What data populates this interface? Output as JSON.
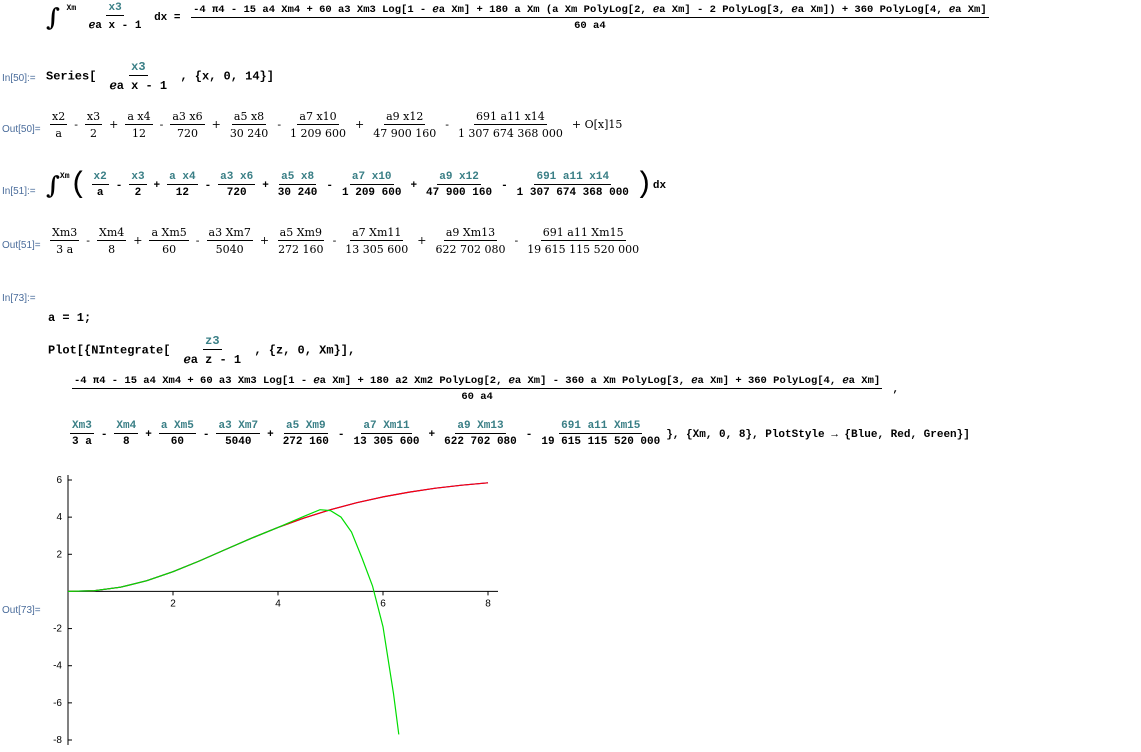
{
  "cells": {
    "top_expr": {
      "lhs_int_upper": "Xm",
      "lhs_int_lower": "0",
      "lhs_num": "x3",
      "lhs_den": "ℯa x - 1",
      "lhs_dx": "dx =",
      "rhs_num": "-4 π4 - 15 a4 Xm4 + 60 a3 Xm3 Log[1 - ℯa Xm] + 180 a Xm (a Xm PolyLog[2, ℯa Xm] - 2 PolyLog[3, ℯa Xm]) + 360 PolyLog[4, ℯa Xm]",
      "rhs_den": "60 a4"
    },
    "in50": {
      "label": "In[50]:=",
      "text_pre": "Series[",
      "num": "x3",
      "den": "ℯa x - 1",
      "text_post": ", {x, 0, 14}]"
    },
    "out50": {
      "label": "Out[50]=",
      "terms": [
        {
          "num": "x2",
          "den": "a",
          "op": "-"
        },
        {
          "num": "x3",
          "den": "2",
          "op": "+"
        },
        {
          "num": "a x4",
          "den": "12",
          "op": "-"
        },
        {
          "num": "a3 x6",
          "den": "720",
          "op": "+"
        },
        {
          "num": "a5 x8",
          "den": "30 240",
          "op": "-"
        },
        {
          "num": "a7 x10",
          "den": "1 209 600",
          "op": "+"
        },
        {
          "num": "a9 x12",
          "den": "47 900 160",
          "op": "-"
        },
        {
          "num": "691 a11 x14",
          "den": "1 307 674 368 000",
          "op": "+ O[x]15"
        }
      ]
    },
    "in51": {
      "label": "In[51]:=",
      "upper": "Xm",
      "lower": "0",
      "terms": [
        {
          "num": "x2",
          "den": "a",
          "op": "-"
        },
        {
          "num": "x3",
          "den": "2",
          "op": "+"
        },
        {
          "num": "a x4",
          "den": "12",
          "op": "-"
        },
        {
          "num": "a3 x6",
          "den": "720",
          "op": "+"
        },
        {
          "num": "a5 x8",
          "den": "30 240",
          "op": "-"
        },
        {
          "num": "a7 x10",
          "den": "1 209 600",
          "op": "+"
        },
        {
          "num": "a9 x12",
          "den": "47 900 160",
          "op": "-"
        },
        {
          "num": "691 a11 x14",
          "den": "1 307 674 368 000",
          "op": ""
        }
      ],
      "dx": "dx"
    },
    "out51": {
      "label": "Out[51]=",
      "terms": [
        {
          "num": "Xm3",
          "den": "3 a",
          "op": "-"
        },
        {
          "num": "Xm4",
          "den": "8",
          "op": "+"
        },
        {
          "num": "a Xm5",
          "den": "60",
          "op": "-"
        },
        {
          "num": "a3 Xm7",
          "den": "5040",
          "op": "+"
        },
        {
          "num": "a5 Xm9",
          "den": "272 160",
          "op": "-"
        },
        {
          "num": "a7 Xm11",
          "den": "13 305 600",
          "op": "+"
        },
        {
          "num": "a9 Xm13",
          "den": "622 702 080",
          "op": "-"
        },
        {
          "num": "691 a11 Xm15",
          "den": "19 615 115 520 000",
          "op": ""
        }
      ]
    },
    "in73": {
      "label": "In[73]:=",
      "line1": "a = 1;",
      "plot_pre": "Plot[{NIntegrate[",
      "plot_num": "z3",
      "plot_den": "ℯa z - 1",
      "plot_post": ", {z, 0, Xm}],",
      "line3_num": "-4 π4 - 15 a4 Xm4 + 60 a3 Xm3 Log[1 - ℯa Xm] + 180 a2 Xm2 PolyLog[2, ℯa Xm] - 360 a Xm PolyLog[3, ℯa Xm] + 360 PolyLog[4, ℯa Xm]",
      "line3_den": "60 a4",
      "line3_post": ",",
      "line4_terms": [
        {
          "num": "Xm3",
          "den": "3 a",
          "op": "-"
        },
        {
          "num": "Xm4",
          "den": "8",
          "op": "+"
        },
        {
          "num": "a Xm5",
          "den": "60",
          "op": "-"
        },
        {
          "num": "a3 Xm7",
          "den": "5040",
          "op": "+"
        },
        {
          "num": "a5 Xm9",
          "den": "272 160",
          "op": "-"
        },
        {
          "num": "a7 Xm11",
          "den": "13 305 600",
          "op": "+"
        },
        {
          "num": "a9 Xm13",
          "den": "622 702 080",
          "op": "-"
        },
        {
          "num": "691 a11 Xm15",
          "den": "19 615 115 520 000",
          "op": ""
        }
      ],
      "line4_post": "}, {Xm, 0, 8}, PlotStyle → {Blue, Red, Green}]"
    },
    "out73": {
      "label": "Out[73]="
    }
  },
  "chart_data": {
    "type": "line",
    "xlim": [
      0,
      8
    ],
    "ylim": [
      -8,
      6
    ],
    "xticks": [
      2,
      4,
      6,
      8
    ],
    "yticks": [
      -8,
      -6,
      -4,
      -2,
      2,
      4,
      6
    ],
    "series": [
      {
        "color": "#0000ff",
        "x": [
          0,
          0.5,
          1,
          1.5,
          2,
          2.5,
          3,
          3.5,
          4,
          4.5,
          5,
          5.5,
          6,
          6.5,
          7,
          7.5,
          8
        ],
        "y": [
          0,
          0.04,
          0.23,
          0.58,
          1.06,
          1.64,
          2.26,
          2.87,
          3.45,
          3.96,
          4.4,
          4.78,
          5.09,
          5.35,
          5.56,
          5.72,
          5.85
        ]
      },
      {
        "color": "#ff0000",
        "x": [
          0,
          0.5,
          1,
          1.5,
          2,
          2.5,
          3,
          3.5,
          4,
          4.5,
          5,
          5.5,
          6,
          6.5,
          7,
          7.5,
          8
        ],
        "y": [
          0,
          0.04,
          0.23,
          0.58,
          1.06,
          1.64,
          2.26,
          2.87,
          3.45,
          3.96,
          4.4,
          4.78,
          5.09,
          5.35,
          5.56,
          5.72,
          5.85
        ]
      },
      {
        "color": "#00dd00",
        "x": [
          0,
          0.5,
          1,
          1.5,
          2,
          2.5,
          3,
          3.5,
          4,
          4.5,
          4.8,
          5,
          5.2,
          5.4,
          5.6,
          5.8,
          6,
          6.2,
          6.3
        ],
        "y": [
          0,
          0.04,
          0.23,
          0.58,
          1.06,
          1.64,
          2.26,
          2.87,
          3.45,
          4.05,
          4.4,
          4.35,
          4.0,
          3.2,
          1.8,
          0.3,
          -1.9,
          -5.5,
          -7.7
        ]
      }
    ]
  }
}
